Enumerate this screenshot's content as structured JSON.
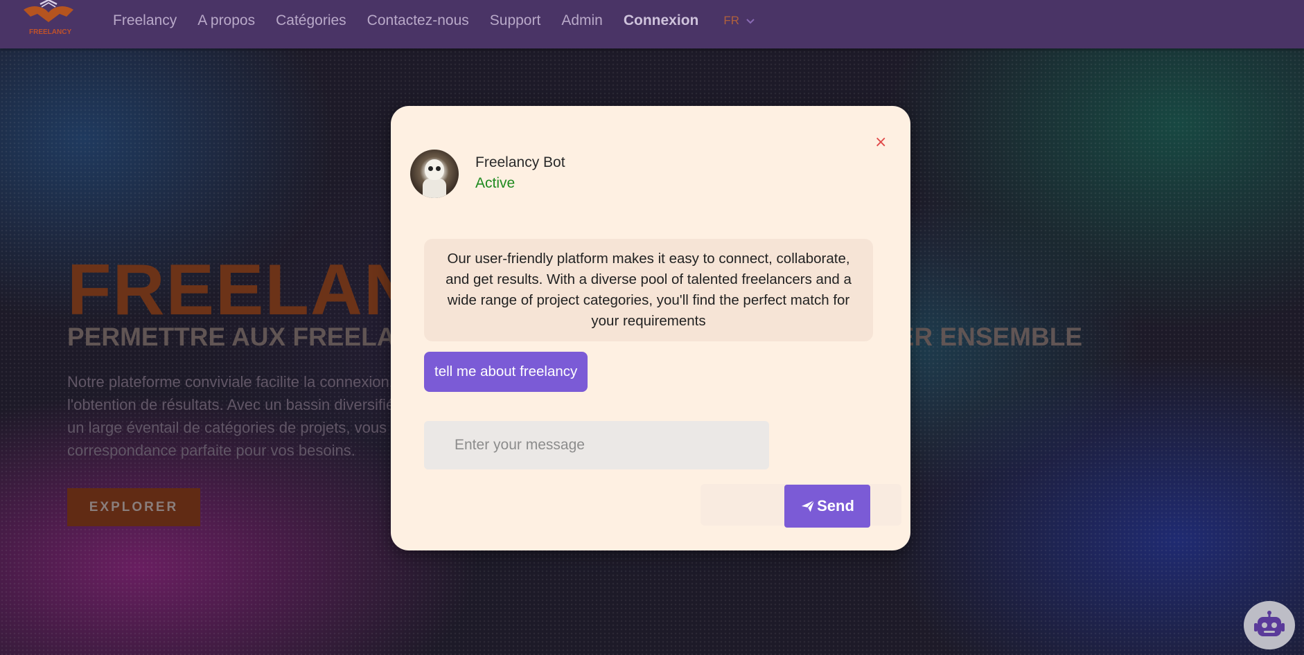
{
  "nav": {
    "logo_text": "FREELANCY",
    "links": [
      "Freelancy",
      "A propos",
      "Catégories",
      "Contactez-nous",
      "Support",
      "Admin"
    ],
    "login": "Connexion",
    "language": "FR"
  },
  "hero": {
    "title": "FREELANCY",
    "subtitle": "PERMETTRE AUX FREELANCERS ET AUX CLIENTS DE COLLABORER ENSEMBLE",
    "description": "Notre plateforme conviviale facilite la connexion, la collaboration et l'obtention de résultats. Avec un bassin diversifié de pigistes talentueux et un large éventail de catégories de projets, vous trouverez la correspondance parfaite pour vos besoins.",
    "explore_label": "EXPLORER"
  },
  "chat": {
    "bot_name": "Freelancy Bot",
    "status": "Active",
    "close_label": "×",
    "bot_message": "Our user-friendly platform makes it easy to connect, collaborate, and get results. With a diverse pool of talented freelancers and a wide range of project categories, you'll find the perfect match for your requirements",
    "user_message": "tell me about freelancy",
    "input_placeholder": "Enter your message",
    "send_label": "Send"
  },
  "colors": {
    "nav_bg": "#4a3466",
    "accent": "#7b5bd6",
    "modal_bg": "#fef0e2",
    "hero_title": "#9b4516",
    "status": "#1f8a1f"
  },
  "icons": {
    "close": "close-icon",
    "send": "paper-plane-icon",
    "lang_dropdown": "chevron-down-icon",
    "fab": "robot-icon"
  }
}
